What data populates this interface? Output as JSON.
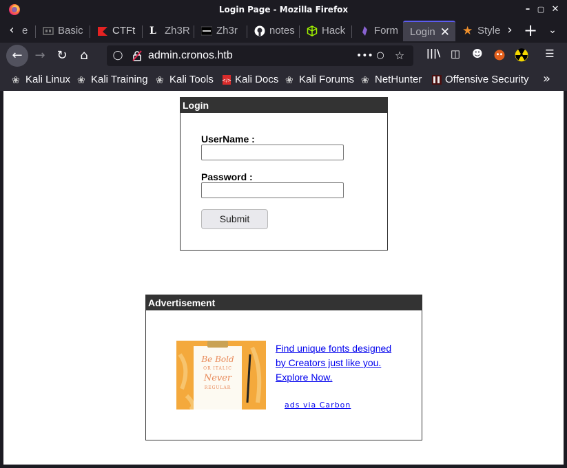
{
  "window": {
    "title": "Login Page - Mozilla Firefox"
  },
  "tabs": [
    {
      "label": "e",
      "icon": "page-icon"
    },
    {
      "label": "Basic",
      "icon": "basic-icon"
    },
    {
      "label": "CTFt",
      "icon": "ctf-icon"
    },
    {
      "label": "Zh3R",
      "icon": "l-icon"
    },
    {
      "label": "Zh3r",
      "icon": "zh3r-icon"
    },
    {
      "label": "notes",
      "icon": "github-icon"
    },
    {
      "label": "Hack",
      "icon": "hackthebox-icon"
    },
    {
      "label": "Form",
      "icon": "crystal-icon"
    },
    {
      "label": "Login",
      "icon": "none",
      "active": true
    },
    {
      "label": "Style",
      "icon": "star-icon"
    }
  ],
  "navbar": {
    "url": "admin.cronos.htb"
  },
  "bookmarks": [
    {
      "label": "Kali Linux",
      "icon": "kali-icon"
    },
    {
      "label": "Kali Training",
      "icon": "kali-icon"
    },
    {
      "label": "Kali Tools",
      "icon": "kali-icon"
    },
    {
      "label": "Kali Docs",
      "icon": "kali-docs-icon"
    },
    {
      "label": "Kali Forums",
      "icon": "kali-icon"
    },
    {
      "label": "NetHunter",
      "icon": "kali-icon"
    },
    {
      "label": "Offensive Security",
      "icon": "offsec-icon"
    }
  ],
  "login": {
    "heading": "Login",
    "username_label": "UserName :",
    "username_value": "",
    "password_label": "Password :",
    "password_value": "",
    "submit_label": "Submit"
  },
  "ad": {
    "heading": "Advertisement",
    "link_text": "Find unique fonts designed by Creators just like you. Explore Now.",
    "via_text": "ads via Carbon",
    "image_text": [
      "Be Bold",
      "OR ITALIC",
      "Never",
      "REGULAR"
    ]
  },
  "colors": {
    "accent": "#5c5cf0",
    "chrome_dark": "#1c1b22",
    "chrome": "#2b2a33",
    "panel_head": "#333333",
    "link": "#0000ee"
  }
}
